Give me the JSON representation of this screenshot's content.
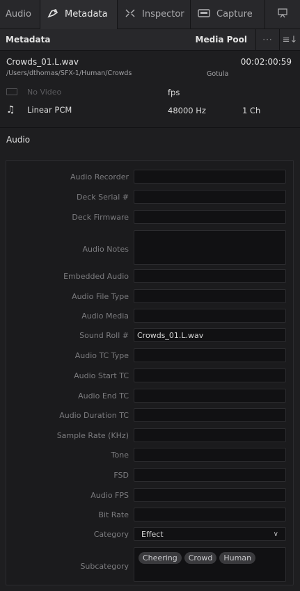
{
  "tabs": [
    {
      "label": "Audio",
      "icon": "none"
    },
    {
      "label": "Metadata",
      "icon": "metadata-icon"
    },
    {
      "label": "Inspector",
      "icon": "inspector-icon"
    },
    {
      "label": "Capture",
      "icon": "capture-icon"
    }
  ],
  "header": {
    "title": "Metadata",
    "media_pool": "Media Pool",
    "more": "···",
    "sort": "≡↓"
  },
  "clip": {
    "name": "Crowds_01.L.wav",
    "duration": "00:02:00:59",
    "path": "/Users/dthomas/SFX-1/Human/Crowds",
    "source": "Gotula",
    "video": "No Video",
    "fps": "fps",
    "audio_codec": "Linear PCM",
    "sample_rate": "48000 Hz",
    "channels": "1 Ch"
  },
  "section": {
    "title": "Audio"
  },
  "fields": [
    {
      "label": "Audio Recorder",
      "value": ""
    },
    {
      "label": "Deck Serial #",
      "value": ""
    },
    {
      "label": "Deck Firmware",
      "value": ""
    },
    {
      "label": "Audio Notes",
      "value": ""
    },
    {
      "label": "Embedded Audio",
      "value": ""
    },
    {
      "label": "Audio File Type",
      "value": ""
    },
    {
      "label": "Audio Media",
      "value": ""
    },
    {
      "label": "Sound Roll #",
      "value": "Crowds_01.L.wav"
    },
    {
      "label": "Audio TC Type",
      "value": ""
    },
    {
      "label": "Audio Start TC",
      "value": ""
    },
    {
      "label": "Audio End TC",
      "value": ""
    },
    {
      "label": "Audio Duration TC",
      "value": ""
    },
    {
      "label": "Sample Rate (KHz)",
      "value": ""
    },
    {
      "label": "Tone",
      "value": ""
    },
    {
      "label": "FSD",
      "value": ""
    },
    {
      "label": "Audio FPS",
      "value": ""
    },
    {
      "label": "Bit Rate",
      "value": ""
    },
    {
      "label": "Category",
      "value": "Effect"
    },
    {
      "label": "Subcategory",
      "value": ""
    }
  ],
  "subcategory_tags": [
    "Cheering",
    "Crowd",
    "Human"
  ],
  "colors": {
    "background": "#1e1e20",
    "panel": "#28282b",
    "input": "#111113",
    "tag": "#3a3a3d"
  }
}
